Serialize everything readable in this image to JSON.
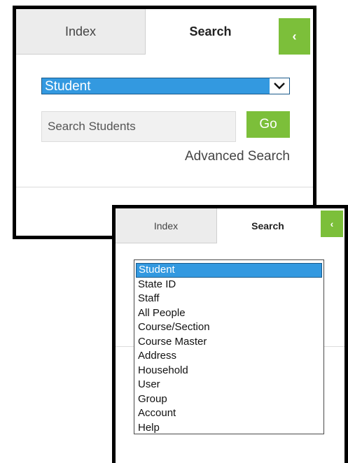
{
  "panel_back": {
    "tabs": {
      "index": "Index",
      "search": "Search"
    },
    "collapse_glyph": "‹",
    "search_type": "Student",
    "search_input": {
      "placeholder": "Search Students",
      "value": ""
    },
    "go_label": "Go",
    "advanced_label": "Advanced Search"
  },
  "panel_front": {
    "tabs": {
      "index": "Index",
      "search": "Search"
    },
    "collapse_glyph": "‹",
    "options": [
      "Student",
      "State ID",
      "Staff",
      "All People",
      "Course/Section",
      "Course Master",
      "Address",
      "Household",
      "User",
      "Group",
      "Account",
      "Help"
    ],
    "selected_option": "Student"
  },
  "colors": {
    "accent_green": "#7cbf3a",
    "select_blue": "#3399e0"
  }
}
